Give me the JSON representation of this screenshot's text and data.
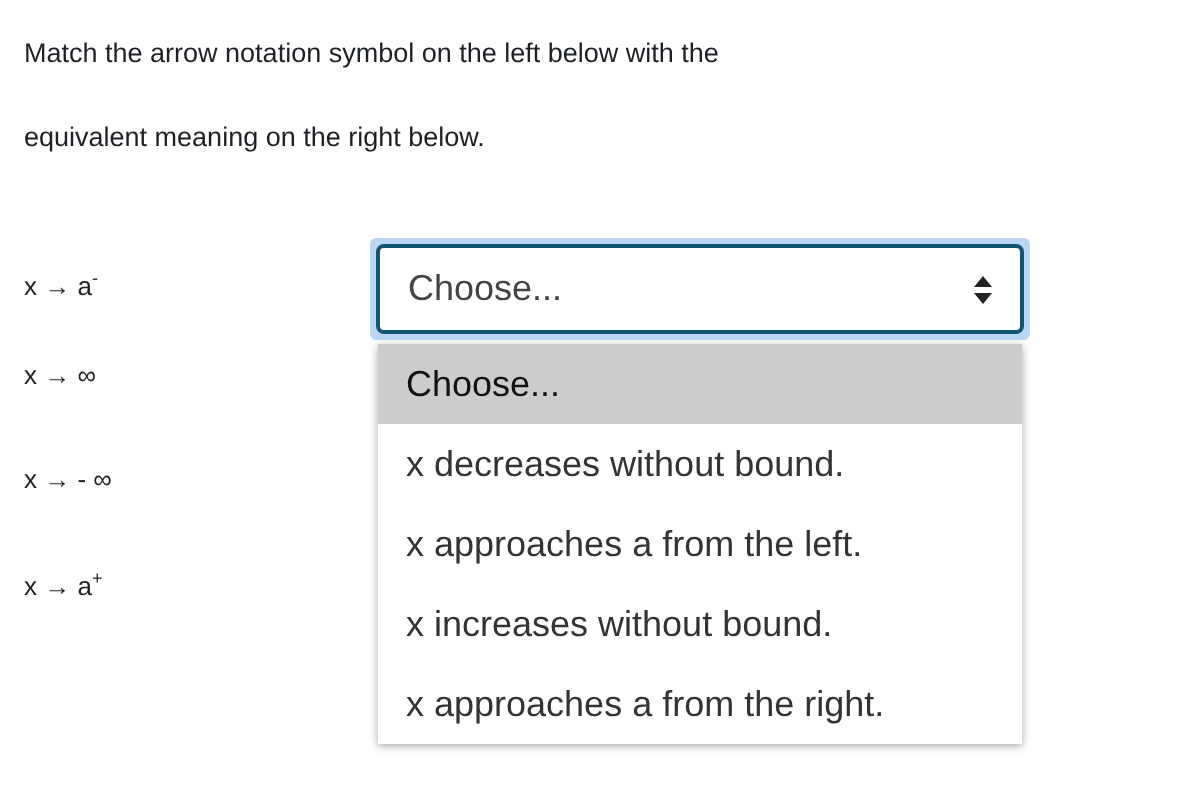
{
  "instructions": "Match the arrow notation symbol on the left below with the equivalent meaning on the right below.",
  "rows": [
    {
      "symbol": "x → a$^{-}$"
    },
    {
      "symbol": "x → ∞"
    },
    {
      "symbol": "x → - ∞"
    },
    {
      "symbol": "x → a$^{+}$"
    }
  ],
  "select": {
    "value": "Choose...",
    "expanded": true,
    "options": [
      {
        "label": "Choose...",
        "selected": true
      },
      {
        "label": "x decreases without bound.",
        "selected": false
      },
      {
        "label": "x approaches a from the left.",
        "selected": false
      },
      {
        "label": "x increases without bound.",
        "selected": false
      },
      {
        "label": "x approaches a from the right.",
        "selected": false
      }
    ]
  }
}
